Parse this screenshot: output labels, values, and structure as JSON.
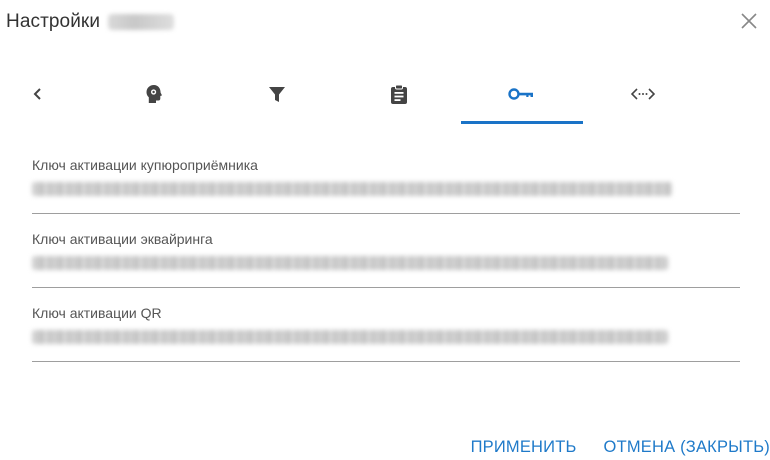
{
  "dialog": {
    "title": "Настройки",
    "close_icon": "close-icon"
  },
  "tabs": [
    {
      "icon": "chevron-left-icon"
    },
    {
      "icon": "head-gear-icon"
    },
    {
      "icon": "filter-icon"
    },
    {
      "icon": "clipboard-icon"
    },
    {
      "icon": "key-icon",
      "selected": true
    },
    {
      "icon": "code-icon"
    }
  ],
  "fields": [
    {
      "label": "Ключ активации купюроприёмника"
    },
    {
      "label": "Ключ активации эквайринга"
    },
    {
      "label": "Ключ активации QR"
    }
  ],
  "actions": {
    "apply_label": "ПРИМЕНИТЬ",
    "cancel_label": "ОТМЕНА (ЗАКРЫТЬ)"
  },
  "colors": {
    "accent": "#1a73c7",
    "icon": "#444444",
    "divider": "#9e9e9e"
  }
}
